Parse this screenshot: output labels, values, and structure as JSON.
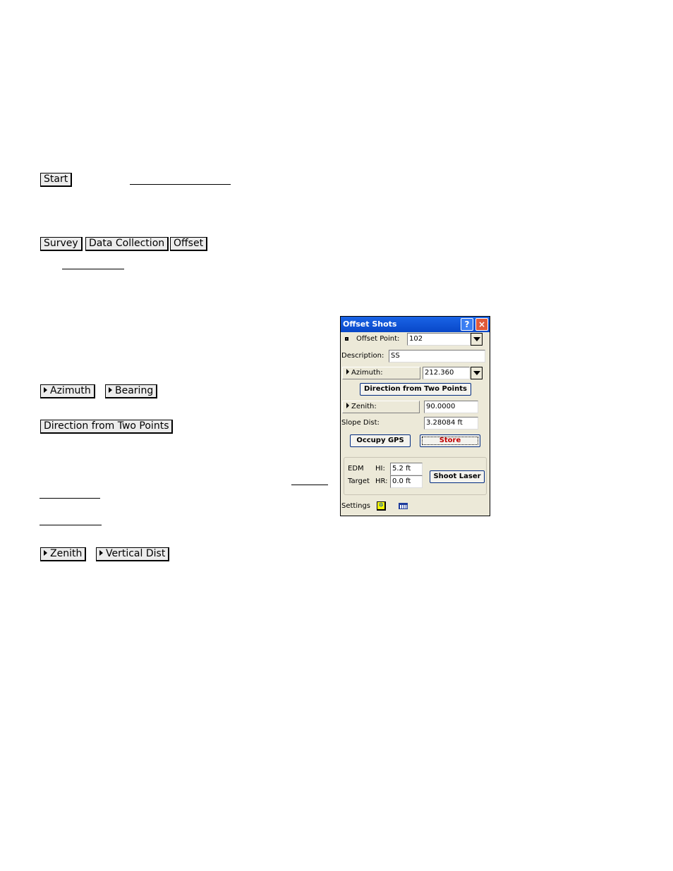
{
  "document": {
    "keys": {
      "start": "Start",
      "survey": "Survey",
      "data_collection": "Data Collection",
      "offset": "Offset",
      "azimuth": "Azimuth",
      "bearing": "Bearing",
      "direction_from_two_points": "Direction from Two Points",
      "zenith": "Zenith",
      "vertical_dist": "Vertical Dist"
    }
  },
  "dialog": {
    "title": "Offset Shots",
    "help_icon": "?",
    "close_icon": "×",
    "offset_point_label": "Offset Point:",
    "offset_point_value": "102",
    "description_label": "Description:",
    "description_value": "SS",
    "azimuth_button": "Azimuth:",
    "azimuth_value": "212.360",
    "direction_button": "Direction from Two Points",
    "zenith_button": "Zenith:",
    "zenith_value": "90.0000",
    "slope_dist_label": "Slope Dist:",
    "slope_dist_value": "3.28084 ft",
    "occupy_gps_button": "Occupy GPS",
    "store_button": "Store",
    "edm_label": "EDM",
    "hi_label": "HI:",
    "hi_value": "5.2 ft",
    "target_label": "Target",
    "hr_label": "HR:",
    "hr_value": "0.0 ft",
    "shoot_laser_button": "Shoot Laser",
    "settings_label": "Settings",
    "settings_star_icon": "✲"
  },
  "colors": {
    "title_bar": "#0a4fd6",
    "dialog_bg": "#ece9d8",
    "store_text": "#c00000"
  }
}
